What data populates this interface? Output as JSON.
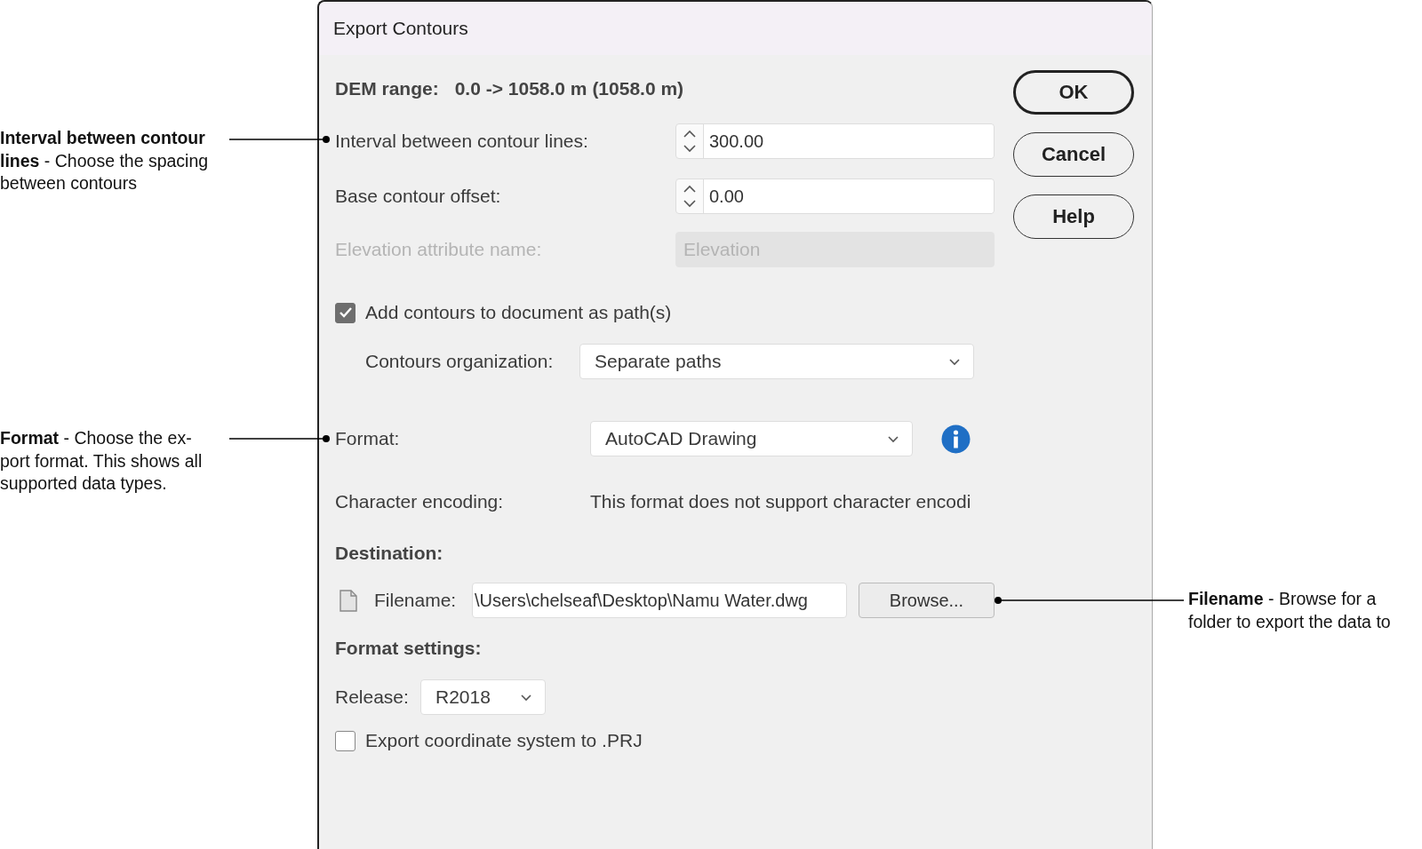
{
  "window": {
    "title": "Export Contours"
  },
  "dem_range": {
    "label": "DEM range:",
    "value": "0.0 -> 1058.0 m (1058.0 m)"
  },
  "fields": [
    {
      "kind": "spinner",
      "label": "Interval between contour lines:",
      "value": "300.00",
      "disabled": false
    },
    {
      "kind": "spinner",
      "label": "Base contour offset:",
      "value": "0.00",
      "disabled": false
    },
    {
      "kind": "text",
      "label": "Elevation attribute name:",
      "value": "Elevation",
      "disabled": true
    }
  ],
  "add_contours": {
    "label": "Add contours to document as path(s)",
    "checked": true
  },
  "organization": {
    "label": "Contours organization:",
    "value": "Separate paths"
  },
  "format": {
    "label": "Format:",
    "value": "AutoCAD Drawing"
  },
  "encoding": {
    "label": "Character encoding:",
    "value": "This format does not support character encodi"
  },
  "destination": {
    "heading": "Destination:",
    "label": "Filename:",
    "value": "\\Users\\chelseaf\\Desktop\\Namu Water.dwg",
    "browse": "Browse..."
  },
  "format_settings": {
    "heading": "Format settings:",
    "release_label": "Release:",
    "release": "R2018"
  },
  "export_prj": {
    "label": "Export coordinate system to .PRJ",
    "checked": false
  },
  "buttons": [
    {
      "label": "OK",
      "default": true
    },
    {
      "label": "Cancel",
      "default": false
    },
    {
      "label": "Help",
      "default": false
    }
  ],
  "callouts": {
    "left": [
      {
        "text": "**Interval between contour**\n**lines** - Choose the spacing\nbetween contours"
      },
      {
        "text": "**Format** - Choose the ex-\nport format. This shows all\nsupported data types."
      }
    ],
    "right": [
      {
        "text": "**Filename** - Browse for a\nfolder to export the data to"
      }
    ]
  }
}
